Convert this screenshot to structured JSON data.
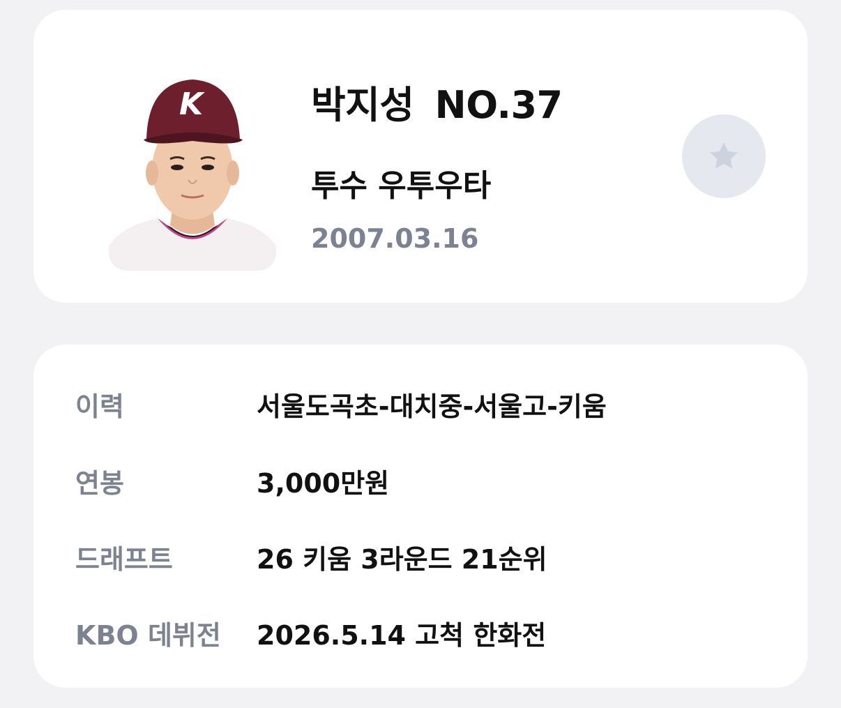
{
  "player": {
    "name": "박지성",
    "number": "NO.37",
    "position": "투수 우투우타",
    "birthdate": "2007.03.16",
    "photo_icon": "player-photo",
    "cap_letter": "K"
  },
  "favorite": {
    "icon": "star-icon",
    "active": false
  },
  "info": {
    "rows": [
      {
        "label": "이력",
        "value": "서울도곡초-대치중-서울고-키움"
      },
      {
        "label": "연봉",
        "value": "3,000만원"
      },
      {
        "label": "드래프트",
        "value": "26 키움 3라운드 21순위"
      },
      {
        "label": "KBO 데뷔전",
        "value": "2026.5.14 고척 한화전"
      }
    ]
  },
  "colors": {
    "background": "#f2f2f4",
    "card": "#ffffff",
    "primary_text": "#111111",
    "secondary_text": "#7c8290",
    "favorite_bg": "#e5e8ee",
    "favorite_star": "#cdd3de",
    "cap": "#6e1f2e"
  }
}
